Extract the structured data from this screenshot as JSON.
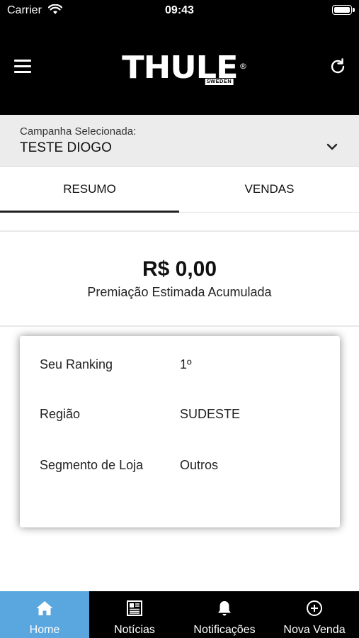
{
  "status_bar": {
    "carrier": "Carrier",
    "time": "09:43"
  },
  "header": {
    "logo_text": "THULE",
    "logo_sub": "SWEDEN",
    "logo_reg": "®"
  },
  "campaign": {
    "label": "Campanha Selecionada:",
    "value": "TESTE DIOGO"
  },
  "tabs": [
    {
      "label": "RESUMO",
      "active": true
    },
    {
      "label": "VENDAS",
      "active": false
    }
  ],
  "summary": {
    "amount": "R$ 0,00",
    "caption": "Premiação Estimada Acumulada"
  },
  "card": {
    "rows": [
      {
        "key": "Seu Ranking",
        "value": "1º"
      },
      {
        "key": "Região",
        "value": "SUDESTE"
      },
      {
        "key": "Segmento de Loja",
        "value": "Outros"
      }
    ]
  },
  "tabbar": {
    "items": [
      {
        "label": "Home",
        "icon": "home-icon",
        "active": true
      },
      {
        "label": "Notícias",
        "icon": "newspaper-icon",
        "active": false
      },
      {
        "label": "Notificações",
        "icon": "bell-icon",
        "active": false
      },
      {
        "label": "Nova Venda",
        "icon": "plus-circle-icon",
        "active": false
      }
    ]
  },
  "colors": {
    "header_bg": "#000000",
    "tab_active_bg": "#5aa6df",
    "campaign_bg": "#ececec"
  }
}
